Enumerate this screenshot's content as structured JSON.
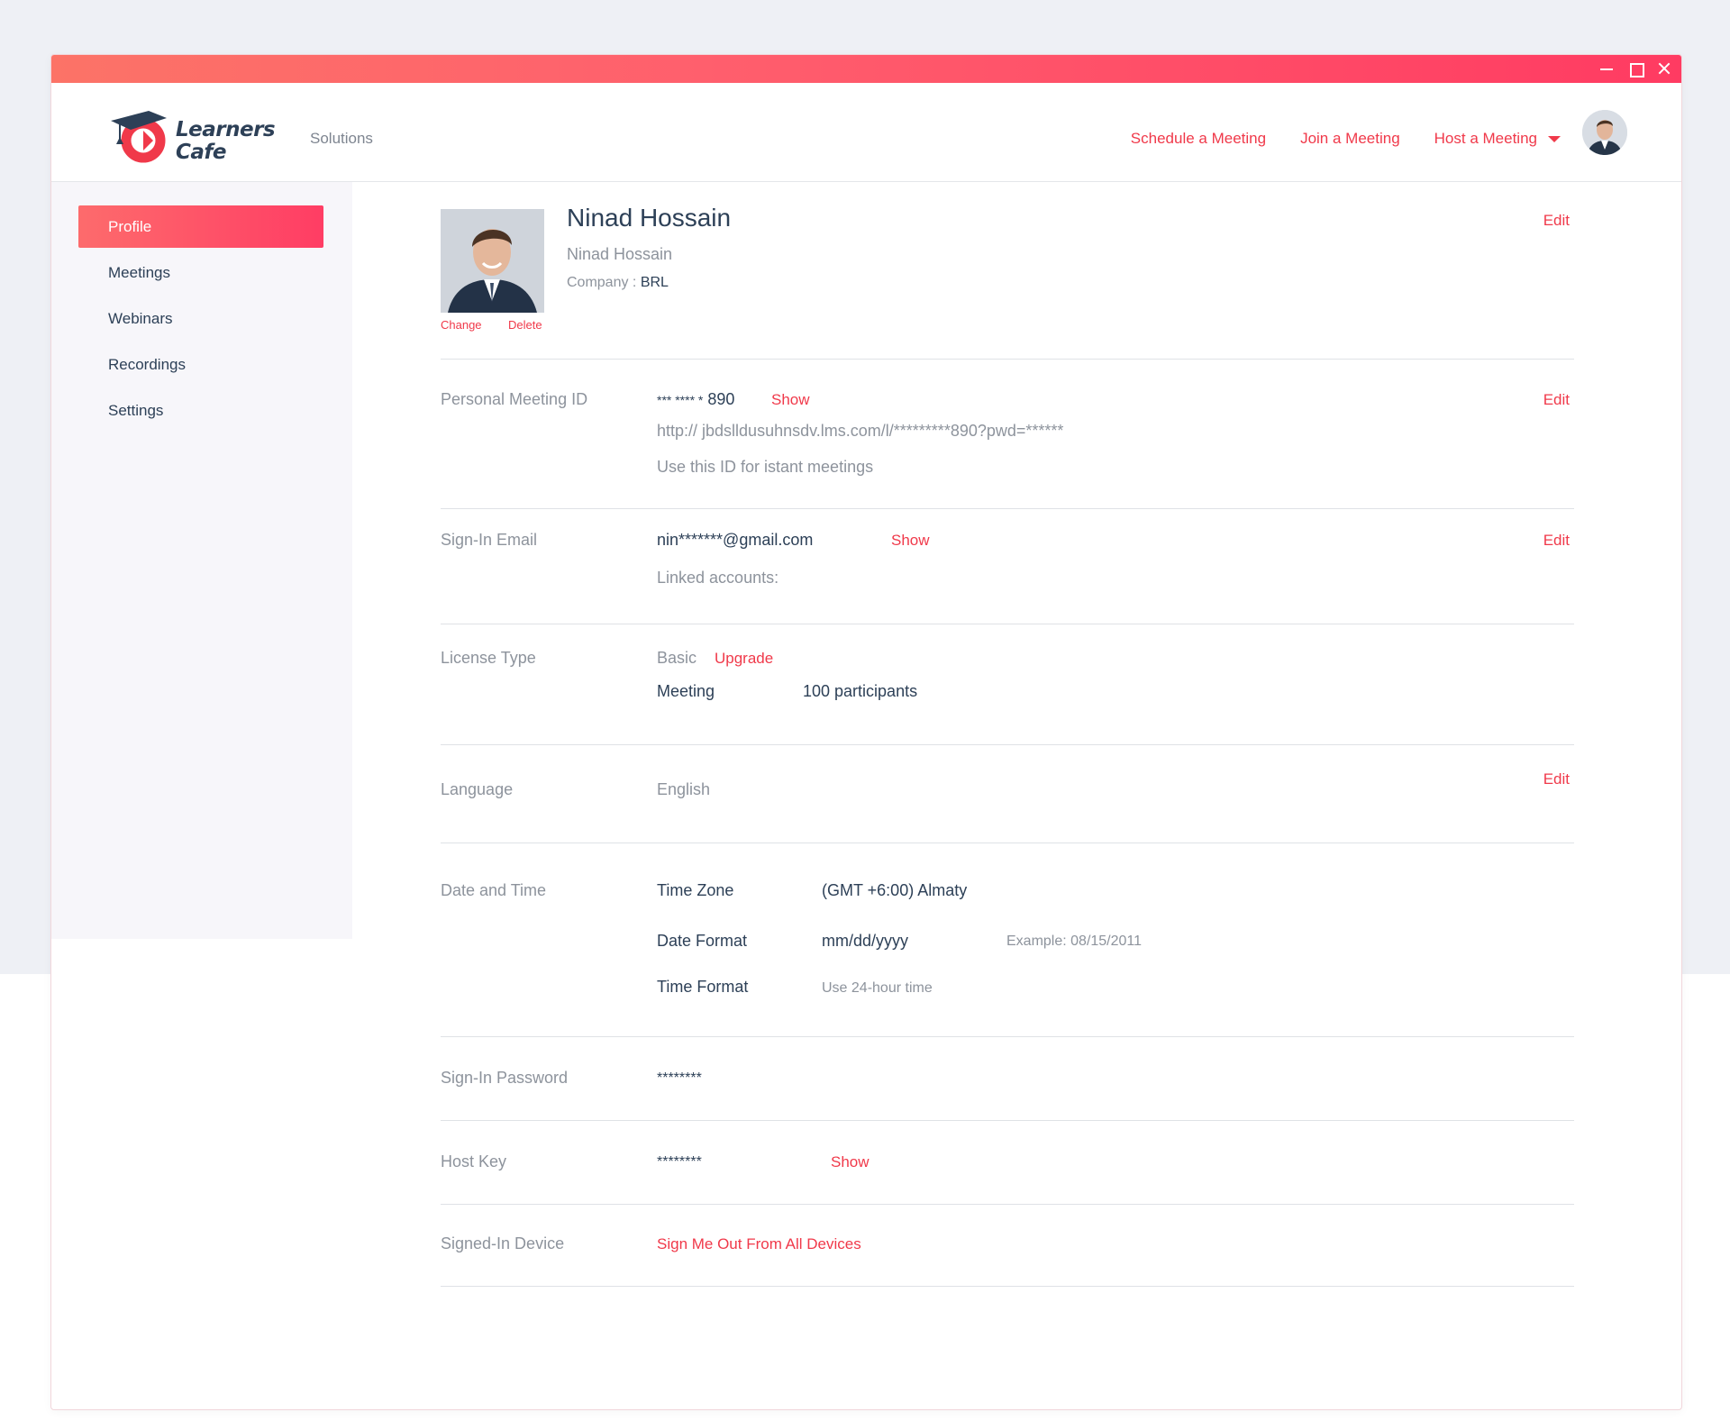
{
  "app": {
    "logo_line1": "Learners",
    "logo_line2": "Cafe",
    "brand_color": "#ff3d64",
    "accent_red": "#f0394a",
    "text_dark": "#2d4057"
  },
  "header": {
    "solutions": "Solutions",
    "schedule": "Schedule a Meeting",
    "join": "Join a Meeting",
    "host": "Host a Meeting"
  },
  "sidebar": {
    "items": [
      {
        "label": "Profile",
        "active": true
      },
      {
        "label": "Meetings",
        "active": false
      },
      {
        "label": "Webinars",
        "active": false
      },
      {
        "label": "Recordings",
        "active": false
      },
      {
        "label": "Settings",
        "active": false
      }
    ]
  },
  "profile": {
    "name": "Ninad Hossain",
    "display_name": "Ninad Hossain",
    "company_label": "Company :",
    "company": "BRL",
    "change": "Change",
    "delete": "Delete",
    "edit": "Edit"
  },
  "meeting_id": {
    "label": "Personal Meeting ID",
    "id_mask": "*** **** *",
    "id_tail": "890",
    "show": "Show",
    "url": "http:// jbdslldusuhnsdv.lms.com/l/*********890?pwd=******",
    "hint": "Use this ID for istant meetings",
    "edit": "Edit"
  },
  "email": {
    "label": "Sign-In Email",
    "value": "nin*******@gmail.com",
    "show": "Show",
    "linked": "Linked accounts:",
    "edit": "Edit"
  },
  "license": {
    "label": "License Type",
    "value": "Basic",
    "upgrade": "Upgrade",
    "meeting_label": "Meeting",
    "participants": "100 participants"
  },
  "language": {
    "label": "Language",
    "value": "English",
    "edit": "Edit"
  },
  "datetime": {
    "label": "Date and Time",
    "tz_label": "Time Zone",
    "tz_value": "(GMT +6:00) Almaty",
    "df_label": "Date Format",
    "df_value": "mm/dd/yyyy",
    "df_example": "Example: 08/15/2011",
    "tf_label": "Time Format",
    "tf_value": "Use 24-hour time"
  },
  "password": {
    "label": "Sign-In Password",
    "value": "********"
  },
  "host_key": {
    "label": "Host Key",
    "value": "********",
    "show": "Show"
  },
  "device": {
    "label": "Signed-In Device",
    "action": "Sign Me Out From All Devices"
  }
}
